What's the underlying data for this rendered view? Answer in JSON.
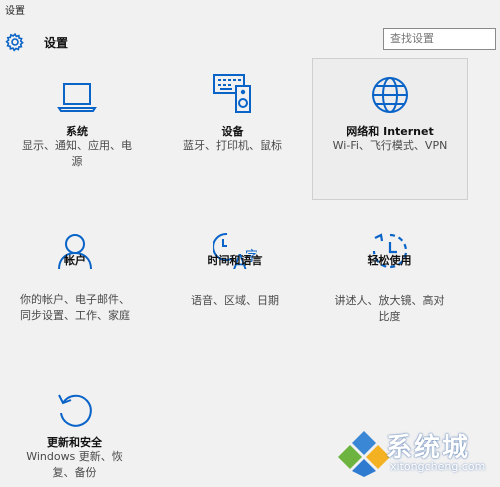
{
  "window": {
    "title": "设置"
  },
  "header": {
    "title": "设置",
    "icon": "gear-icon"
  },
  "search": {
    "placeholder": "查找设置"
  },
  "accent_color": "#0a64c8",
  "tiles": [
    {
      "label": "系统",
      "desc": "显示、通知、应用、电\n源",
      "icon": "laptop-icon"
    },
    {
      "label": "设备",
      "desc": "蓝牙、打印机、鼠标",
      "icon": "keyboard-speaker-icon"
    },
    {
      "label": "网络和 Internet",
      "desc": "Wi-Fi、飞行模式、VPN",
      "icon": "globe-icon"
    },
    {
      "label": "帐户",
      "desc": "你的帐户、电子邮件、\n同步设置、工作、家庭",
      "icon": "person-icon"
    },
    {
      "label": "时间和语言",
      "desc": "语音、区域、日期",
      "icon": "time-language-icon"
    },
    {
      "label": "轻松使用",
      "desc": "讲述人、放大镜、高对\n比度",
      "icon": "ease-of-access-icon"
    },
    {
      "label": "更新和安全",
      "desc": "Windows 更新、恢\n复、备份",
      "icon": "refresh-icon"
    }
  ],
  "watermark": {
    "text": "系统城",
    "sub": "xitongcheng.com"
  }
}
